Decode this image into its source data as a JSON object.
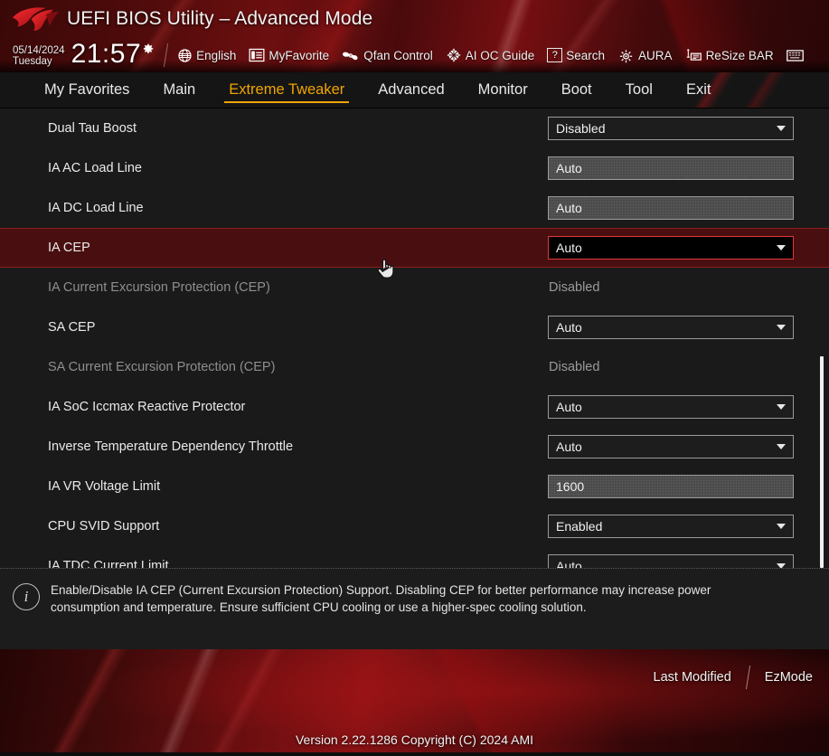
{
  "header": {
    "logo_icon": "rog-eye-logo",
    "title": "UEFI BIOS Utility – Advanced Mode",
    "date": "05/14/2024",
    "weekday": "Tuesday",
    "time": "21:57",
    "gear_icon": "gear-icon",
    "tools": [
      {
        "label": "English",
        "icon": "globe-icon"
      },
      {
        "label": "MyFavorite",
        "icon": "favorites-list-icon"
      },
      {
        "label": "Qfan Control",
        "icon": "fan-icon"
      },
      {
        "label": "AI OC Guide",
        "icon": "ai-chip-icon"
      },
      {
        "label": "Search",
        "icon": "question-box-icon"
      },
      {
        "label": "AURA",
        "icon": "aura-light-icon"
      },
      {
        "label": "ReSize BAR",
        "icon": "resize-bar-icon"
      },
      {
        "label": "",
        "icon": "hot-keys-icon"
      }
    ]
  },
  "tabs": [
    {
      "label": "My Favorites",
      "active": false
    },
    {
      "label": "Main",
      "active": false
    },
    {
      "label": "Extreme Tweaker",
      "active": true
    },
    {
      "label": "Advanced",
      "active": false
    },
    {
      "label": "Monitor",
      "active": false
    },
    {
      "label": "Boot",
      "active": false
    },
    {
      "label": "Tool",
      "active": false
    },
    {
      "label": "Exit",
      "active": false
    }
  ],
  "settings": [
    {
      "label": "Dual Tau Boost",
      "value": "Disabled",
      "control": "select",
      "state": "normal"
    },
    {
      "label": "IA AC Load Line",
      "value": "Auto",
      "control": "input",
      "state": "normal"
    },
    {
      "label": "IA DC Load Line",
      "value": "Auto",
      "control": "input",
      "state": "normal"
    },
    {
      "label": "IA CEP",
      "value": "Auto",
      "control": "select",
      "state": "highlight"
    },
    {
      "label": "IA Current Excursion Protection (CEP)",
      "value": "Disabled",
      "control": "static",
      "state": "disabled"
    },
    {
      "label": "SA CEP",
      "value": "Auto",
      "control": "select",
      "state": "normal"
    },
    {
      "label": "SA Current Excursion Protection (CEP)",
      "value": "Disabled",
      "control": "static",
      "state": "disabled"
    },
    {
      "label": "IA SoC Iccmax Reactive Protector",
      "value": "Auto",
      "control": "select",
      "state": "normal"
    },
    {
      "label": "Inverse Temperature Dependency Throttle",
      "value": "Auto",
      "control": "select",
      "state": "normal"
    },
    {
      "label": "IA VR Voltage Limit",
      "value": "1600",
      "control": "input",
      "state": "normal"
    },
    {
      "label": "CPU SVID Support",
      "value": "Enabled",
      "control": "select",
      "state": "normal"
    },
    {
      "label": "IA TDC Current Limit",
      "value": "Auto",
      "control": "select",
      "state": "normal"
    }
  ],
  "help": {
    "icon": "info-icon",
    "text": "Enable/Disable IA CEP (Current Excursion Protection) Support. Disabling CEP for better performance may increase power consumption and temperature. Ensure sufficient CPU cooling or use a higher-spec cooling solution."
  },
  "footer": {
    "last_modified": "Last Modified",
    "ez_mode": "EzMode",
    "version": "Version 2.22.1286 Copyright (C) 2024 AMI"
  },
  "colors": {
    "accent_gold": "#f0a500",
    "rog_red": "#c0171a",
    "highlight_row": "#490f10",
    "panel_bg": "#1a1a1a"
  }
}
